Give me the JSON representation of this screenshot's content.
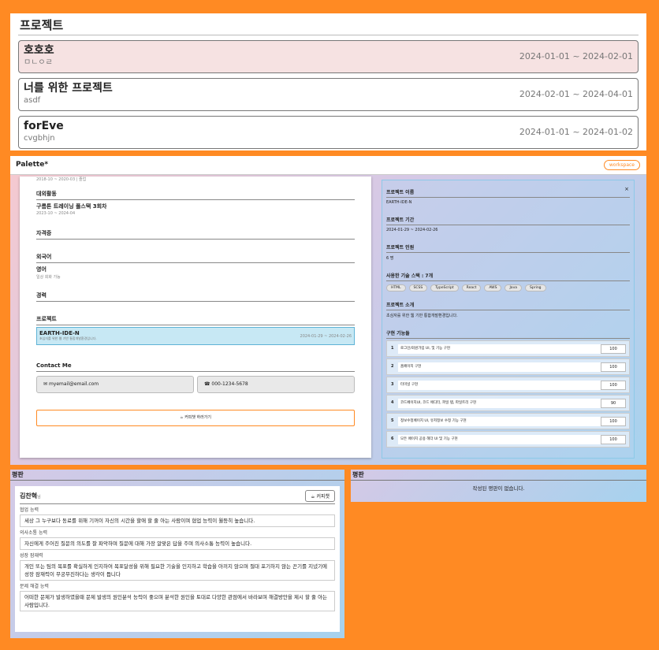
{
  "projects": {
    "title": "프로젝트",
    "items": [
      {
        "name": "호호호",
        "desc": "ㅁㄴㅇㄹ",
        "dates": "2024-01-01 ~ 2024-02-01"
      },
      {
        "name": "너를 위한 프로젝트",
        "desc": "asdf",
        "dates": "2024-02-01 ~ 2024-04-01"
      },
      {
        "name": "forEve",
        "desc": "cvgbhjn",
        "dates": "2024-01-01 ~ 2024-01-02"
      }
    ]
  },
  "palette": {
    "brand": "Palette*",
    "workspace": "workspace",
    "top_line": "2018-10 ~ 2020-03 | 졸업",
    "activity": {
      "label": "대외활동",
      "title": "구름톤 트레이닝 풀스택 3회차",
      "dates": "2023-10 ~ 2024-04"
    },
    "cert": {
      "label": "자격증"
    },
    "lang": {
      "label": "외국어",
      "title": "영어",
      "note": "일상 회화 가능"
    },
    "career": {
      "label": "경력"
    },
    "project": {
      "label": "프로젝트",
      "name": "EARTH-IDE-N",
      "desc": "초심자를 위한 웹 기반 통합개발환경입니다.",
      "dates": "2024-01-29 ~ 2024-02-26"
    },
    "contact": {
      "label": "Contact Me",
      "email": "myemail@email.com",
      "phone": "000-1234-5678"
    },
    "coffee": "커피챗 하러가기"
  },
  "detail": {
    "close": "×",
    "name_label": "프로젝트 이름",
    "name": "EARTH-IDE-N",
    "period_label": "프로젝트 기간",
    "period": "2024-01-29 ~ 2024-02-26",
    "people_label": "프로젝트 인원",
    "people": "6 명",
    "stack_label": "사용한 기술 스택 : 7개",
    "stack": [
      "HTML",
      "SCSS",
      "TypeScript",
      "React",
      "AWS",
      "Java",
      "Spring"
    ],
    "intro_label": "프로젝트 소개",
    "intro": "초심자를 위한 웹 기반 통합개발환경입니다.",
    "features_label": "구현 기능들",
    "features": [
      {
        "num": "1",
        "name": "로그인/회원가입 UI, 및 기능 구현",
        "value": 100
      },
      {
        "num": "2",
        "name": "홈페이지 구현",
        "value": 100
      },
      {
        "num": "3",
        "name": "터미널 구현",
        "value": 100
      },
      {
        "num": "4",
        "name": "코드페이지UI, 코드 에디터, 파일 탭, 파일트리 구현",
        "value": 90
      },
      {
        "num": "5",
        "name": "정보수정페이지 UI, 유저정보 수정 기능 구현",
        "value": 100
      },
      {
        "num": "6",
        "name": "모든 페이지 공용 헤더 UI 및 기능 구현",
        "value": 100
      }
    ]
  },
  "reviews": {
    "title": "평판",
    "reviewer": "김찬혁",
    "suffix": "님",
    "coffee": "커피챗",
    "items": [
      {
        "cat": "협업 능력",
        "text": "세상 그 누구보다 동료를 위해 기꺼이 자신의 시간을 할애 할 줄 아는 사람이며 협업 능력이 월등히 높습니다."
      },
      {
        "cat": "의사소통 능력",
        "text": "자신에게 주어진 질문의 의도를 잘 파악하며 질문에 대해 가장 알맞은 답을 주며 의사소통 능력이 높습니다."
      },
      {
        "cat": "성장 잠재력",
        "text": "개인 또는 팀의 목표를 확실하게 인지하여 목표달성을 위해 필요한 기술을 인지하고 학습을 아끼지 않으며 절대 포기하지 않는 끈기를 지녔기에 성장 잠재력이 무궁무진하다는 생각이 듭니다"
      },
      {
        "cat": "문제 해결 능력",
        "text": "어떠한 문제가 발생하였을때 문제 발생의 원인분석 능력이 좋으며 분석한 원인을 토대로 다양한 관점에서 바라보며 해결방안을 제시 할 줄 아는 사람입니다."
      }
    ]
  },
  "reviews2": {
    "title": "평판",
    "empty": "작성된 평판이 없습니다."
  }
}
